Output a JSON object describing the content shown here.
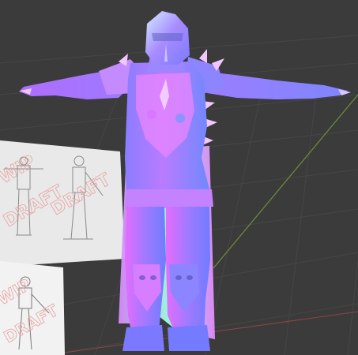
{
  "viewport": {
    "background": "#3b3b3b",
    "grid_color": "#474747",
    "x_axis_color": "#9a4a4a",
    "y_axis_color": "#7d9b3a"
  },
  "reference_images": [
    {
      "name": "wip-concept-sheet-front-side",
      "watermark": [
        "WIP",
        "DRAFT",
        "DRAFT"
      ]
    },
    {
      "name": "wip-concept-sheet-detail",
      "watermark": [
        "WIP",
        "DRAFT"
      ]
    }
  ],
  "model": {
    "name": "armored-knight-character",
    "pose": "T-pose",
    "shading": "normal-map",
    "colors": {
      "blue": "#6b86ff",
      "violet": "#b16bff",
      "magenta": "#e06bff",
      "pink": "#ff7ad9",
      "cyan": "#8ef0ff",
      "green": "#a7ffb2"
    }
  }
}
